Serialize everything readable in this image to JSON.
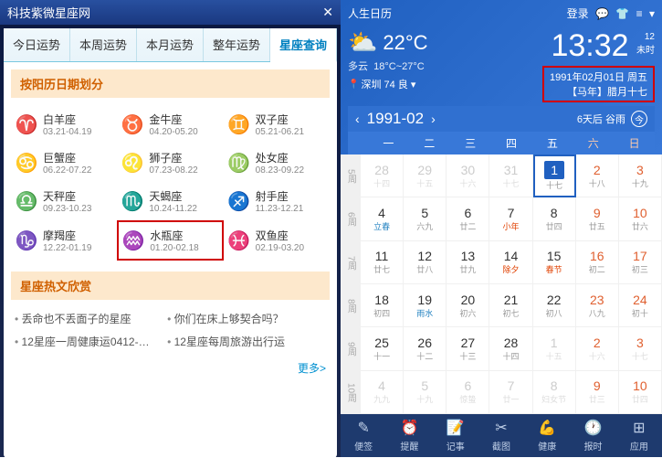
{
  "left": {
    "title": "科技紫微星座网",
    "tabs": [
      "今日运势",
      "本周运势",
      "本月运势",
      "整年运势",
      "星座查询"
    ],
    "active_tab": 4,
    "section1": "按阳历日期划分",
    "zodiac": [
      {
        "sym": "♈",
        "name": "白羊座",
        "dates": "03.21-04.19"
      },
      {
        "sym": "♉",
        "name": "金牛座",
        "dates": "04.20-05.20"
      },
      {
        "sym": "♊",
        "name": "双子座",
        "dates": "05.21-06.21"
      },
      {
        "sym": "♋",
        "name": "巨蟹座",
        "dates": "06.22-07.22"
      },
      {
        "sym": "♌",
        "name": "狮子座",
        "dates": "07.23-08.22"
      },
      {
        "sym": "♍",
        "name": "处女座",
        "dates": "08.23-09.22"
      },
      {
        "sym": "♎",
        "name": "天秤座",
        "dates": "09.23-10.23"
      },
      {
        "sym": "♏",
        "name": "天蝎座",
        "dates": "10.24-11.22"
      },
      {
        "sym": "♐",
        "name": "射手座",
        "dates": "11.23-12.21"
      },
      {
        "sym": "♑",
        "name": "摩羯座",
        "dates": "12.22-01.19"
      },
      {
        "sym": "♒",
        "name": "水瓶座",
        "dates": "01.20-02.18"
      },
      {
        "sym": "♓",
        "name": "双鱼座",
        "dates": "02.19-03.20"
      }
    ],
    "highlight_index": 10,
    "section2": "星座热文欣赏",
    "articles": [
      "丢命也不丢面子的星座",
      "你们在床上够契合吗？",
      "12星座一周健康运0412-…",
      "12星座每周旅游出行运"
    ],
    "more": "更多>"
  },
  "right": {
    "app": "人生日历",
    "login": "登录",
    "temp": "22°C",
    "cond": "多云",
    "range": "18°C~27°C",
    "time": "13:32",
    "tside1": "12",
    "tside2": "未时",
    "date1": "1991年02月01日 周五",
    "date2": "【马年】腊月十七",
    "loc": "深圳 74 良",
    "month": "1991-02",
    "solar": "6天后 谷雨",
    "today": "今",
    "dow": [
      "一",
      "二",
      "三",
      "四",
      "五",
      "六",
      "日"
    ],
    "weeks": [
      "5周",
      "6周",
      "7周",
      "8周",
      "9周",
      "10周"
    ],
    "cells": [
      [
        {
          "d": "28",
          "l": "十四",
          "dim": 1
        },
        {
          "d": "29",
          "l": "十五",
          "dim": 1
        },
        {
          "d": "30",
          "l": "十六",
          "dim": 1
        },
        {
          "d": "31",
          "l": "十七",
          "dim": 1
        },
        {
          "d": "1",
          "l": "十七",
          "sel": 1
        },
        {
          "d": "2",
          "l": "十八",
          "wk": 1
        },
        {
          "d": "3",
          "l": "十九",
          "wk": 1
        }
      ],
      [
        {
          "d": "4",
          "l": "立春",
          "st": 1
        },
        {
          "d": "5",
          "l": "六九"
        },
        {
          "d": "6",
          "l": "廿二"
        },
        {
          "d": "7",
          "l": "小年",
          "ho": 1
        },
        {
          "d": "8",
          "l": "廿四"
        },
        {
          "d": "9",
          "l": "廿五",
          "wk": 1
        },
        {
          "d": "10",
          "l": "廿六",
          "wk": 1
        }
      ],
      [
        {
          "d": "11",
          "l": "廿七"
        },
        {
          "d": "12",
          "l": "廿八"
        },
        {
          "d": "13",
          "l": "廿九"
        },
        {
          "d": "14",
          "l": "除夕",
          "ho": 1
        },
        {
          "d": "15",
          "l": "春节",
          "ho": 1
        },
        {
          "d": "16",
          "l": "初二",
          "wk": 1
        },
        {
          "d": "17",
          "l": "初三",
          "wk": 1
        }
      ],
      [
        {
          "d": "18",
          "l": "初四"
        },
        {
          "d": "19",
          "l": "雨水",
          "st": 1
        },
        {
          "d": "20",
          "l": "初六"
        },
        {
          "d": "21",
          "l": "初七"
        },
        {
          "d": "22",
          "l": "初八"
        },
        {
          "d": "23",
          "l": "八九",
          "wk": 1
        },
        {
          "d": "24",
          "l": "初十",
          "wk": 1
        }
      ],
      [
        {
          "d": "25",
          "l": "十一"
        },
        {
          "d": "26",
          "l": "十二"
        },
        {
          "d": "27",
          "l": "十三"
        },
        {
          "d": "28",
          "l": "十四"
        },
        {
          "d": "1",
          "l": "十五",
          "dim": 1
        },
        {
          "d": "2",
          "l": "十六",
          "dim": 1,
          "wk": 1
        },
        {
          "d": "3",
          "l": "十七",
          "dim": 1,
          "wk": 1
        }
      ],
      [
        {
          "d": "4",
          "l": "九九",
          "dim": 1
        },
        {
          "d": "5",
          "l": "十九",
          "dim": 1
        },
        {
          "d": "6",
          "l": "惊蛰",
          "dim": 1
        },
        {
          "d": "7",
          "l": "廿一",
          "dim": 1
        },
        {
          "d": "8",
          "l": "妇女节",
          "dim": 1
        },
        {
          "d": "9",
          "l": "廿三",
          "dim": 1,
          "wk": 1
        },
        {
          "d": "10",
          "l": "廿四",
          "dim": 1,
          "wk": 1
        }
      ]
    ],
    "bottom": [
      {
        "i": "✎",
        "t": "便签"
      },
      {
        "i": "⏰",
        "t": "提醒"
      },
      {
        "i": "📝",
        "t": "记事"
      },
      {
        "i": "✂",
        "t": "截图"
      },
      {
        "i": "💪",
        "t": "健康"
      },
      {
        "i": "🕐",
        "t": "报时"
      },
      {
        "i": "⊞",
        "t": "应用"
      }
    ]
  }
}
